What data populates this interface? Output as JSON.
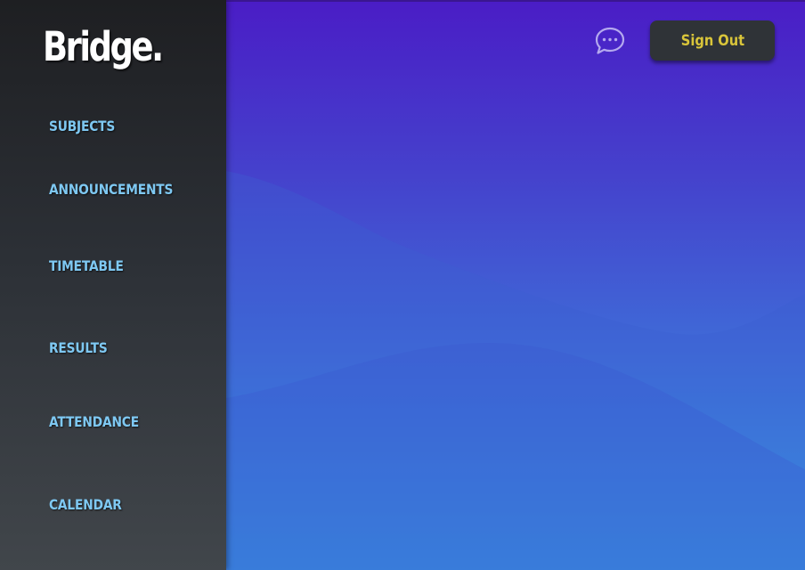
{
  "sidebar": {
    "logo": "Bridge.",
    "items": [
      {
        "label": "SUBJECTS"
      },
      {
        "label": "ANNOUNCEMENTS"
      },
      {
        "label": "TIMETABLE"
      },
      {
        "label": "RESULTS"
      },
      {
        "label": "ATTENDANCE"
      },
      {
        "label": "CALENDAR"
      }
    ]
  },
  "header": {
    "chat_icon": "chat-bubble-icon",
    "sign_out_label": "Sign Out"
  },
  "colors": {
    "sidebar_text": "#7ec8f2",
    "sign_out_text": "#d9c53a",
    "sign_out_bg": "#2f3337",
    "gradient_top": "#4a1dc6",
    "gradient_bottom": "#37a6e6"
  }
}
